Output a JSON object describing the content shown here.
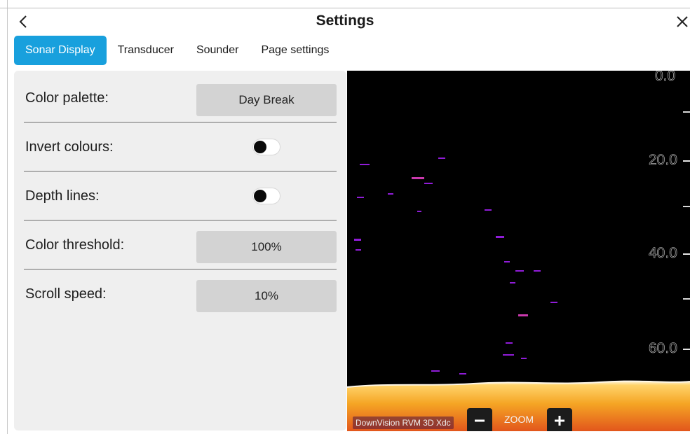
{
  "header": {
    "title": "Settings",
    "back_icon": "chevron-left-icon",
    "close_icon": "close-icon"
  },
  "tabs": [
    {
      "label": "Sonar Display",
      "active": true
    },
    {
      "label": "Transducer",
      "active": false
    },
    {
      "label": "Sounder",
      "active": false
    },
    {
      "label": "Page settings",
      "active": false
    }
  ],
  "settings": {
    "color_palette": {
      "label": "Color palette:",
      "value": "Day Break"
    },
    "invert_colours": {
      "label": "Invert colours:",
      "on": false
    },
    "depth_lines": {
      "label": "Depth lines:",
      "on": false
    },
    "color_threshold": {
      "label": "Color threshold:",
      "value": "100%"
    },
    "scroll_speed": {
      "label": "Scroll speed:",
      "value": "10%"
    }
  },
  "sonar_preview": {
    "depth_scale": [
      "0.0",
      "20.0",
      "40.0",
      "60.0"
    ],
    "source": "DownVision RVM 3D Xdc",
    "zoom_label": "ZOOM",
    "zoom_out_icon": "minus-icon",
    "zoom_in_icon": "plus-icon"
  },
  "colors": {
    "accent": "#18a0dd",
    "panel": "#efefef",
    "value_button": "#d3d3d3",
    "bottom_return": "#f5a524",
    "target_echo": "#a020f0"
  }
}
